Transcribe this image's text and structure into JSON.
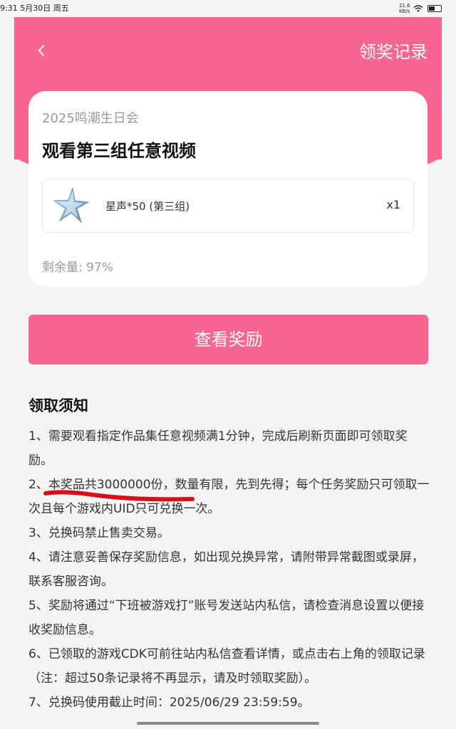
{
  "status_bar": {
    "time": "9:31",
    "date": "5月30日 周五",
    "network_speed": "21.6\nKB/s",
    "icons": [
      "wifi-icon",
      "battery-icon"
    ]
  },
  "header": {
    "back_icon": "chevron-left-icon",
    "record_link": "领奖记录",
    "color": "#f76590"
  },
  "card": {
    "event_name": "2025鸣潮生日会",
    "task_title": "观看第三组任意视频",
    "reward": {
      "icon": "star-crystal-icon",
      "name": "星声*50 (第三组)",
      "quantity": "x1"
    },
    "remaining": "剩余量: 97%"
  },
  "view_reward_button": "查看奖励",
  "notice": {
    "title": "领取须知",
    "items": [
      "1、需要观看指定作品集任意视频满1分钟，完成后刷新页面即可领取奖励。",
      "2、本奖品共3000000份，数量有限，先到先得；每个任务奖励只可领取一次且每个游戏内UID只可兑换一次。",
      "3、兑换码禁止售卖交易。",
      "4、请注意妥善保存奖励信息，如出现兑换异常，请附带异常截图或录屏，联系客服咨询。",
      "5、奖励将通过“下班被游戏打”账号发送站内私信，请检查消息设置以便接收奖励信息。",
      "6、已领取的游戏CDK可前往站内私信查看详情，或点击右上角的领取记录（注：超过50条记录将不再显示，请及时领取奖励）。",
      "7、兑换码使用截止时间：2025/06/29 23:59:59。"
    ]
  }
}
